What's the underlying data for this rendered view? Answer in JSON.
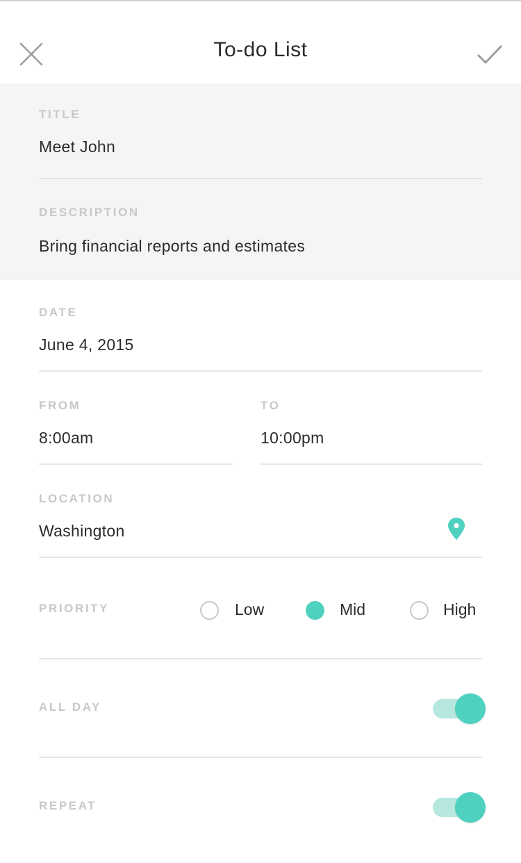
{
  "header": {
    "title": "To-do List",
    "close_icon": "close-icon",
    "confirm_icon": "checkmark-icon"
  },
  "form": {
    "title": {
      "label": "TITLE",
      "value": "Meet John"
    },
    "description": {
      "label": "DESCRIPTION",
      "value": "Bring financial reports and estimates"
    },
    "date": {
      "label": "DATE",
      "value": "June 4, 2015"
    },
    "from": {
      "label": "FROM",
      "value": "8:00am"
    },
    "to": {
      "label": "TO",
      "value": "10:00pm"
    },
    "location": {
      "label": "LOCATION",
      "value": "Washington",
      "icon": "location-pin-icon"
    },
    "priority": {
      "label": "PRIORITY",
      "options": [
        "Low",
        "Mid",
        "High"
      ],
      "selected": "Mid"
    },
    "all_day": {
      "label": "ALL DAY",
      "on": true
    },
    "repeat": {
      "label": "REPEAT",
      "on": true
    }
  },
  "colors": {
    "accent": "#4fd1bf",
    "accent_light": "#b7e8df",
    "panel_bg": "#f5f5f5",
    "label": "#c8c8c8",
    "text": "#2b2b2b"
  }
}
